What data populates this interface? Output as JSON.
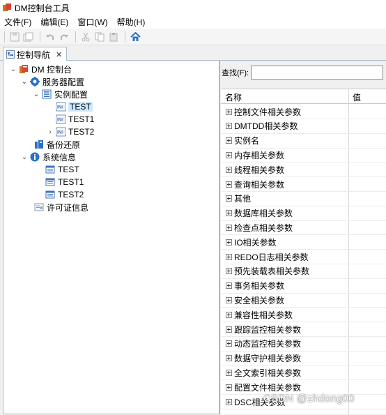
{
  "window": {
    "title": "DM控制台工具"
  },
  "menu": [
    "文件(F)",
    "编辑(E)",
    "窗口(W)",
    "帮助(H)"
  ],
  "toolbar": {
    "icons": [
      "save-icon",
      "save-all-icon",
      "undo-icon",
      "redo-icon",
      "cut-icon",
      "copy-icon",
      "paste-icon",
      "home-icon"
    ]
  },
  "tab": {
    "label": "控制导航",
    "close": "✕"
  },
  "tree": [
    {
      "label": "DM 控制台",
      "icon": "console-icon",
      "arrow": "⌄"
    },
    {
      "label": "服务器配置",
      "icon": "gear-icon",
      "arrow": "⌄"
    },
    {
      "label": "实例配置",
      "icon": "list-icon",
      "arrow": "⌄"
    },
    {
      "label": "TEST",
      "icon": "ini-file-icon",
      "arrow": "",
      "selected": true
    },
    {
      "label": "TEST1",
      "icon": "ini-file-icon",
      "arrow": ""
    },
    {
      "label": "TEST2",
      "icon": "ini-file-icon",
      "arrow": "›"
    },
    {
      "label": "备份还原",
      "icon": "backup-icon",
      "arrow": ""
    },
    {
      "label": "系统信息",
      "icon": "info-icon",
      "arrow": "⌄"
    },
    {
      "label": "TEST",
      "icon": "window-icon",
      "arrow": ""
    },
    {
      "label": "TEST1",
      "icon": "window-icon",
      "arrow": ""
    },
    {
      "label": "TEST2",
      "icon": "window-icon",
      "arrow": ""
    },
    {
      "label": "许可证信息",
      "icon": "license-icon",
      "arrow": ""
    }
  ],
  "search": {
    "label": "查找(F):",
    "value": ""
  },
  "grid": {
    "col_name": "名称",
    "col_value": "值",
    "rows": [
      "控制文件相关参数",
      "DMTDD相关参数",
      "实例名",
      "内存相关参数",
      "线程相关参数",
      "查询相关参数",
      "其他",
      "数据库相关参数",
      "检查点相关参数",
      "IO相关参数",
      "REDO日志相关参数",
      "预先装载表相关参数",
      "事务相关参数",
      "安全相关参数",
      "兼容性相关参数",
      "跟踪监控相关参数",
      "动态监控相关参数",
      "数据守护相关参数",
      "全文索引相关参数",
      "配置文件相关参数",
      "DSC相关参数"
    ]
  },
  "watermark": "CSDN @zhdong00"
}
